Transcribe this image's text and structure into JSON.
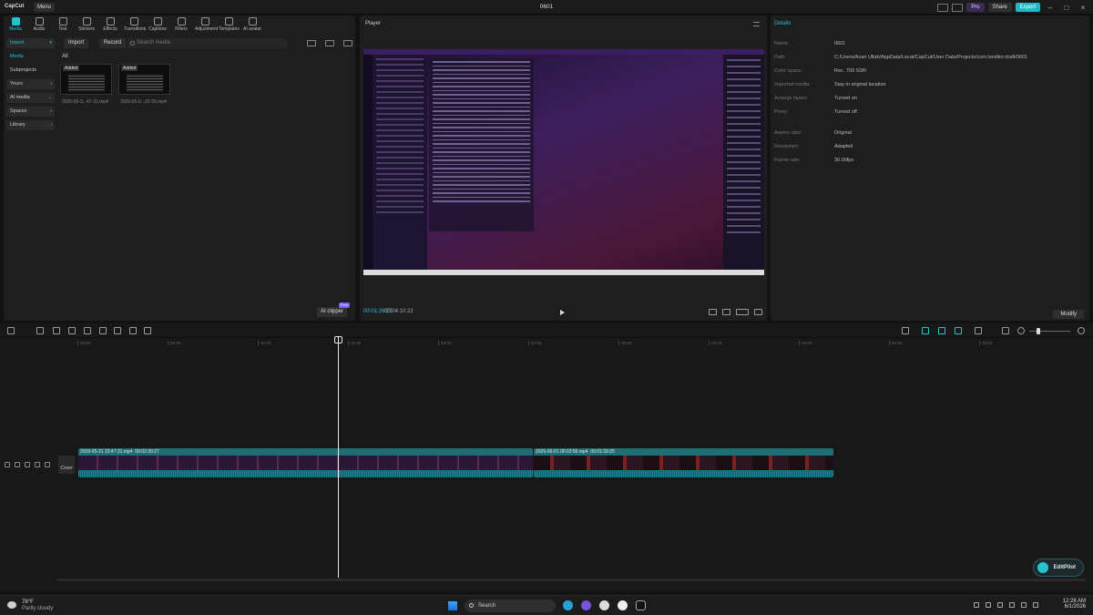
{
  "titlebar": {
    "app_name": "CapCut",
    "menu_label": "Menu",
    "project_title": "0601",
    "pro_label": "Pro",
    "share_label": "Share",
    "export_label": "Export"
  },
  "toolbar": [
    {
      "label": "Media",
      "icon": "media-icon",
      "active": true
    },
    {
      "label": "Audio",
      "icon": "audio-icon"
    },
    {
      "label": "Text",
      "icon": "text-icon"
    },
    {
      "label": "Stickers",
      "icon": "stickers-icon"
    },
    {
      "label": "Effects",
      "icon": "effects-icon"
    },
    {
      "label": "Transitions",
      "icon": "transitions-icon"
    },
    {
      "label": "Captions",
      "icon": "captions-icon"
    },
    {
      "label": "Filters",
      "icon": "filters-icon"
    },
    {
      "label": "Adjustment",
      "icon": "adjustment-icon"
    },
    {
      "label": "Templates",
      "icon": "templates-icon"
    },
    {
      "label": "AI avatar",
      "icon": "ai-avatar-icon"
    }
  ],
  "sidebar": {
    "items": [
      {
        "label": "Import"
      },
      {
        "label": "Media"
      },
      {
        "label": "Subprojects"
      },
      {
        "label": "Yours"
      },
      {
        "label": "AI media"
      },
      {
        "label": "Spaces"
      },
      {
        "label": "Library"
      }
    ]
  },
  "media": {
    "import_label": "Import",
    "record_label": "Record",
    "search_placeholder": "Search media",
    "filter_label": "All",
    "items": [
      {
        "badge": "Added",
        "name": "2026-05-3...47-31.mp4"
      },
      {
        "badge": "Added",
        "name": "2026-06-0...02-56.mp4"
      }
    ],
    "ai_clipper_label": "AI clipper",
    "free_badge": "Free"
  },
  "player": {
    "title": "Player",
    "current_time": "00:01:26:15",
    "total_time": "00:04:10:22"
  },
  "details": {
    "title": "Details",
    "rows": [
      {
        "key": "Name:",
        "value": "0601"
      },
      {
        "key": "Path:",
        "value": "C:/Users/Azan Ullah/AppData/Local/CapCut/User Data/Projects/com.lveditor.draft/0601"
      },
      {
        "key": "Color space:",
        "value": "Rec. 709 SDR"
      },
      {
        "key": "Imported media:",
        "value": "Stay in original location"
      },
      {
        "key": "Arrange layers",
        "value": "Turned on"
      },
      {
        "key": "Proxy:",
        "value": "Turned off"
      },
      {
        "key": "Aspect ratio:",
        "value": "Original"
      },
      {
        "key": "Resolution:",
        "value": "Adapted"
      },
      {
        "key": "Frame rate:",
        "value": "30.00fps"
      }
    ],
    "modify_label": "Modify"
  },
  "timeline": {
    "ticks": [
      "00:00",
      "00:30",
      "01:00",
      "01:30",
      "02:00",
      "02:30",
      "03:00",
      "03:30",
      "04:00",
      "04:30",
      "05:00"
    ],
    "cover_label": "Cover",
    "clips": [
      {
        "name": "2026-05-31 23:47:31.mp4",
        "duration": "00:02:30:27"
      },
      {
        "name": "2026-06-01 00:02:56.mp4",
        "duration": "00:01:39:25"
      }
    ]
  },
  "editpilot_label": "EditPilot",
  "taskbar": {
    "temperature": "78°F",
    "weather": "Partly cloudy",
    "search_label": "Search",
    "time": "12:28 AM",
    "date": "6/1/2026"
  }
}
